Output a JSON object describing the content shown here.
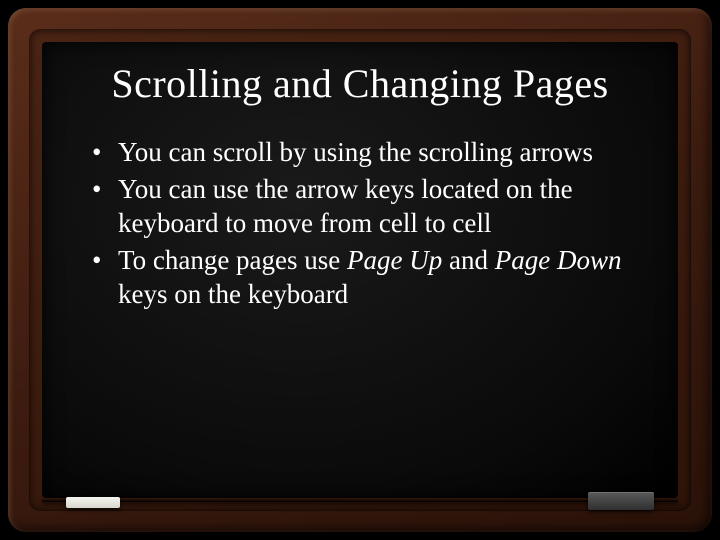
{
  "title": "Scrolling and Changing Pages",
  "bullets": [
    {
      "pre": "You can scroll by using the scrolling arrows",
      "em1": "",
      "mid": "",
      "em2": "",
      "post": ""
    },
    {
      "pre": "You can use the arrow keys located on the keyboard to move from cell to cell",
      "em1": "",
      "mid": "",
      "em2": "",
      "post": ""
    },
    {
      "pre": "To change pages use ",
      "em1": "Page Up",
      "mid": " and ",
      "em2": "Page Down",
      "post": " keys on the keyboard"
    }
  ]
}
